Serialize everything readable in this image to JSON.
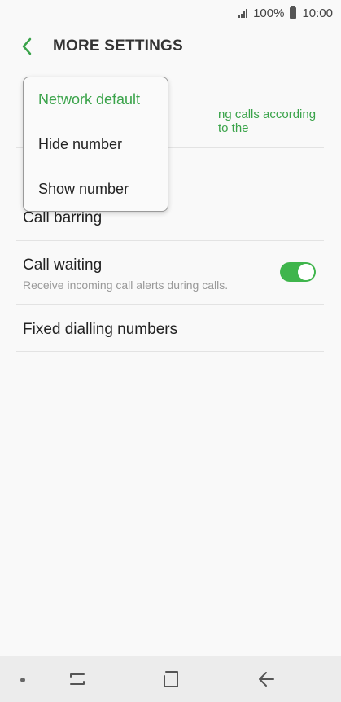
{
  "status_bar": {
    "battery_text": "100%",
    "time": "10:00"
  },
  "header": {
    "title": "MORE SETTINGS",
    "back_icon": "chevron-left-icon",
    "accent_color": "#3aa34a"
  },
  "settings": {
    "caller_id": {
      "subtitle_visible": "ng calls according to the"
    },
    "call_barring": {
      "title": "Call barring"
    },
    "call_waiting": {
      "title": "Call waiting",
      "subtitle": "Receive incoming call alerts during calls.",
      "enabled": true
    },
    "fixed_dialling": {
      "title": "Fixed dialling numbers"
    }
  },
  "popup_menu": {
    "options": [
      {
        "label": "Network default",
        "selected": true
      },
      {
        "label": "Hide number",
        "selected": false
      },
      {
        "label": "Show number",
        "selected": false
      }
    ]
  },
  "nav_bar": {
    "icons": [
      "dot-icon",
      "recent-apps-icon",
      "home-icon",
      "back-icon"
    ]
  }
}
